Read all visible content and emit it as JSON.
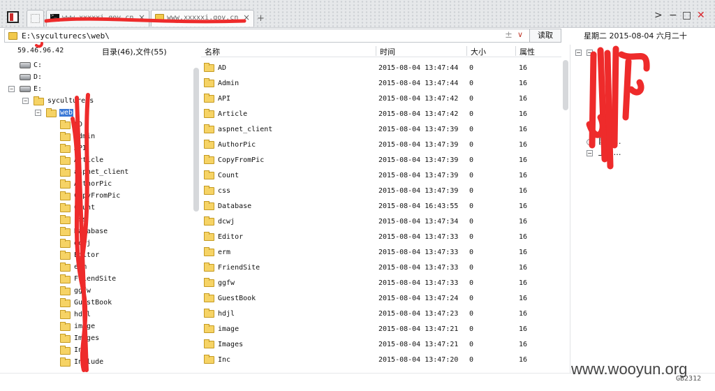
{
  "titlebar": {
    "tabs": [
      {
        "label": "www.xxxxxi.gov.cn",
        "icon": "terminal-icon"
      },
      {
        "label": "www.xxxxxi.gov.cn",
        "icon": "folder-icon"
      }
    ],
    "add_tab": "+",
    "window_buttons": {
      "menu": ">",
      "minimize": "−",
      "maximize": "□",
      "close": "✕"
    }
  },
  "address": {
    "path": "E:\\syculturecs\\web\\",
    "plus": "±",
    "dropdown": "∨",
    "read_button": "读取",
    "datetime": "星期二 2015-08-04 六月二十"
  },
  "info": {
    "ip": "59.46.96.42",
    "counts": "目录(46),文件(55)"
  },
  "tree": {
    "drives": [
      {
        "label": "C:",
        "expander": ""
      },
      {
        "label": "D:",
        "expander": ""
      },
      {
        "label": "E:",
        "expander": "−"
      }
    ],
    "root_folder": {
      "label": "syculturecs",
      "expander": "−"
    },
    "selected_folder": {
      "label": "web",
      "expander": "−"
    },
    "children": [
      "AD",
      "Admin",
      "API",
      "Article",
      "aspnet_client",
      "AuthorPic",
      "CopyFromPic",
      "Count",
      "css",
      "Database",
      "dcwj",
      "Editor",
      "erm",
      "FriendSite",
      "ggfw",
      "GuestBook",
      "hdjl",
      "image",
      "Images",
      "Inc",
      "Include"
    ]
  },
  "list": {
    "columns": {
      "name": "名称",
      "time": "时间",
      "size": "大小",
      "attr": "属性"
    },
    "rows": [
      {
        "name": "AD",
        "time": "2015-08-04 13:47:44",
        "size": "0",
        "attr": "16"
      },
      {
        "name": "Admin",
        "time": "2015-08-04 13:47:44",
        "size": "0",
        "attr": "16"
      },
      {
        "name": "API",
        "time": "2015-08-04 13:47:42",
        "size": "0",
        "attr": "16"
      },
      {
        "name": "Article",
        "time": "2015-08-04 13:47:42",
        "size": "0",
        "attr": "16"
      },
      {
        "name": "aspnet_client",
        "time": "2015-08-04 13:47:39",
        "size": "0",
        "attr": "16"
      },
      {
        "name": "AuthorPic",
        "time": "2015-08-04 13:47:39",
        "size": "0",
        "attr": "16"
      },
      {
        "name": "CopyFromPic",
        "time": "2015-08-04 13:47:39",
        "size": "0",
        "attr": "16"
      },
      {
        "name": "Count",
        "time": "2015-08-04 13:47:39",
        "size": "0",
        "attr": "16"
      },
      {
        "name": "css",
        "time": "2015-08-04 13:47:39",
        "size": "0",
        "attr": "16"
      },
      {
        "name": "Database",
        "time": "2015-08-04 16:43:55",
        "size": "0",
        "attr": "16"
      },
      {
        "name": "dcwj",
        "time": "2015-08-04 13:47:34",
        "size": "0",
        "attr": "16"
      },
      {
        "name": "Editor",
        "time": "2015-08-04 13:47:33",
        "size": "0",
        "attr": "16"
      },
      {
        "name": "erm",
        "time": "2015-08-04 13:47:33",
        "size": "0",
        "attr": "16"
      },
      {
        "name": "FriendSite",
        "time": "2015-08-04 13:47:33",
        "size": "0",
        "attr": "16"
      },
      {
        "name": "ggfw",
        "time": "2015-08-04 13:47:33",
        "size": "0",
        "attr": "16"
      },
      {
        "name": "GuestBook",
        "time": "2015-08-04 13:47:24",
        "size": "0",
        "attr": "16"
      },
      {
        "name": "hdjl",
        "time": "2015-08-04 13:47:23",
        "size": "0",
        "attr": "16"
      },
      {
        "name": "image",
        "time": "2015-08-04 13:47:21",
        "size": "0",
        "attr": "16"
      },
      {
        "name": "Images",
        "time": "2015-08-04 13:47:21",
        "size": "0",
        "attr": "16"
      },
      {
        "name": "Inc",
        "time": "2015-08-04 13:47:20",
        "size": "0",
        "attr": "16"
      }
    ]
  },
  "right_pane": {
    "nodes": [
      {
        "expander": "−",
        "label": ""
      },
      {
        "expander": "−",
        "label": ""
      },
      {
        "expander": "",
        "label": "目标…"
      },
      {
        "expander": "−",
        "label": "上传…"
      }
    ]
  },
  "footer": {
    "watermark": "www.wooyun.org",
    "encoding": "GB2312"
  },
  "colors": {
    "selection": "#3a78d6",
    "redaction": "#ee2b2b",
    "folder": "#f6d365"
  }
}
